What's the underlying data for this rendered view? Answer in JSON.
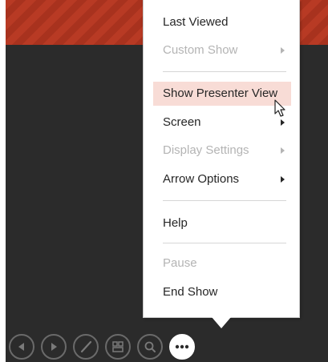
{
  "menu": {
    "items": [
      {
        "label": "Last Viewed",
        "enabled": true,
        "submenu": false,
        "highlighted": false
      },
      {
        "label": "Custom Show",
        "enabled": false,
        "submenu": true,
        "highlighted": false
      },
      {
        "label": "Show Presenter View",
        "enabled": true,
        "submenu": false,
        "highlighted": true
      },
      {
        "label": "Screen",
        "enabled": true,
        "submenu": true,
        "highlighted": false
      },
      {
        "label": "Display Settings",
        "enabled": false,
        "submenu": true,
        "highlighted": false
      },
      {
        "label": "Arrow Options",
        "enabled": true,
        "submenu": true,
        "highlighted": false
      },
      {
        "label": "Help",
        "enabled": true,
        "submenu": false,
        "highlighted": false
      },
      {
        "label": "Pause",
        "enabled": false,
        "submenu": false,
        "highlighted": false
      },
      {
        "label": "End Show",
        "enabled": true,
        "submenu": false,
        "highlighted": false
      }
    ],
    "highlight_color": "#f8dcd6",
    "disabled_text_color": "#b4b4b4"
  },
  "toolbar": {
    "buttons": [
      {
        "name": "previous-slide-button",
        "icon": "arrow-left-icon"
      },
      {
        "name": "next-slide-button",
        "icon": "arrow-right-icon"
      },
      {
        "name": "pen-tool-button",
        "icon": "pen-icon"
      },
      {
        "name": "see-all-slides-button",
        "icon": "slides-grid-icon"
      },
      {
        "name": "zoom-button",
        "icon": "magnifier-icon"
      },
      {
        "name": "more-options-button",
        "icon": "more-dots-icon",
        "active": true
      }
    ]
  },
  "slide": {
    "background_color": "#2b2b2b",
    "stripe_color": "#b83a24"
  }
}
